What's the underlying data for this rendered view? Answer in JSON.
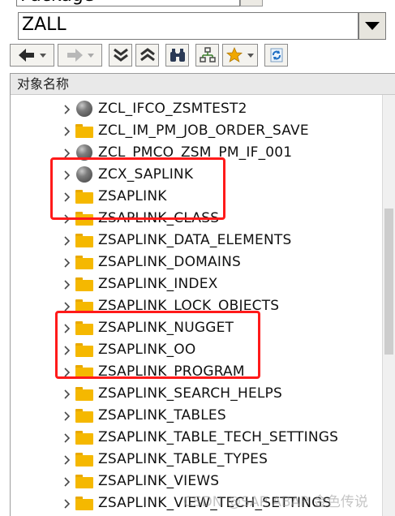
{
  "inputs": {
    "object_type_value": "Package",
    "package_name_value": "ZALL"
  },
  "toolbar": {
    "buttons": [
      "back-icon",
      "forward-icon",
      "expand-all-icon",
      "collapse-all-icon",
      "binoculars-icon",
      "hierarchy-icon",
      "favorites-star-icon",
      "refresh-icon"
    ]
  },
  "tree": {
    "column_header": "对象名称",
    "items": [
      {
        "label": "ZCL_IFCO_ZSMTEST2",
        "icon": "class-ball-icon"
      },
      {
        "label": "ZCL_IM_PM_JOB_ORDER_SAVE",
        "icon": "folder-icon"
      },
      {
        "label": "ZCL_PMCO_ZSM_PM_IF_001",
        "icon": "class-ball-icon"
      },
      {
        "label": "ZCX_SAPLINK",
        "icon": "class-ball-icon"
      },
      {
        "label": "ZSAPLINK",
        "icon": "folder-icon"
      },
      {
        "label": "ZSAPLINK_CLASS",
        "icon": "folder-icon"
      },
      {
        "label": "ZSAPLINK_DATA_ELEMENTS",
        "icon": "folder-icon"
      },
      {
        "label": "ZSAPLINK_DOMAINS",
        "icon": "folder-icon"
      },
      {
        "label": "ZSAPLINK_INDEX",
        "icon": "folder-icon"
      },
      {
        "label": "ZSAPLINK_LOCK_OBJECTS",
        "icon": "folder-icon"
      },
      {
        "label": "ZSAPLINK_NUGGET",
        "icon": "folder-icon"
      },
      {
        "label": "ZSAPLINK_OO",
        "icon": "folder-icon"
      },
      {
        "label": "ZSAPLINK_PROGRAM",
        "icon": "folder-icon"
      },
      {
        "label": "ZSAPLINK_SEARCH_HELPS",
        "icon": "folder-icon"
      },
      {
        "label": "ZSAPLINK_TABLES",
        "icon": "folder-icon"
      },
      {
        "label": "ZSAPLINK_TABLE_TECH_SETTINGS",
        "icon": "folder-icon"
      },
      {
        "label": "ZSAPLINK_TABLE_TYPES",
        "icon": "folder-icon"
      },
      {
        "label": "ZSAPLINK_VIEWS",
        "icon": "folder-icon"
      },
      {
        "label": "ZSAPLINK_VIEW_TECH_SETTINGS",
        "icon": "folder-icon"
      }
    ]
  },
  "watermark": "CSDN @SAP ABAP 金色传说",
  "colors": {
    "highlight_frame": "#ff1a1a",
    "folder": "#f5b800",
    "star": "#f0a800"
  }
}
